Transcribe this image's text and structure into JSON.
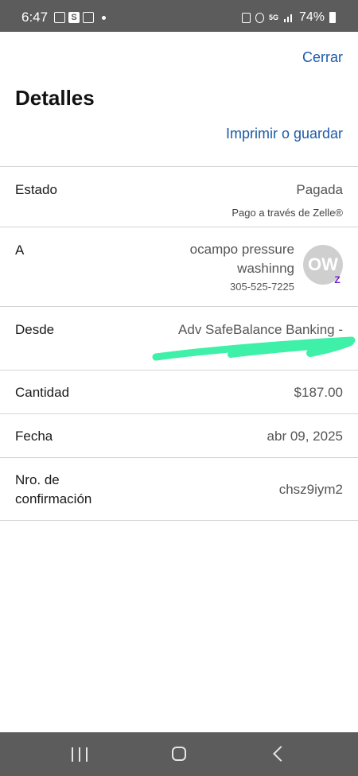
{
  "status_bar": {
    "time": "6:47",
    "battery": "74%",
    "network": "5G"
  },
  "header": {
    "close_label": "Cerrar",
    "title": "Detalles",
    "print_label": "Imprimir o guardar"
  },
  "details": {
    "estado": {
      "label": "Estado",
      "value": "Pagada",
      "sub": "Pago a través de Zelle®"
    },
    "recipient": {
      "label": "A",
      "name": "ocampo pressure washinng",
      "phone": "305-525-7225",
      "initials": "OW",
      "badge": "Z"
    },
    "desde": {
      "label": "Desde",
      "value": "Adv SafeBalance Banking -"
    },
    "cantidad": {
      "label": "Cantidad",
      "value": "$187.00"
    },
    "fecha": {
      "label": "Fecha",
      "value": "abr 09, 2025"
    },
    "confirmacion": {
      "label": "Nro. de confirmación",
      "value": "chsz9iym2"
    }
  },
  "colors": {
    "link": "#1d5aa8",
    "redaction": "#3ef0a8",
    "zelle": "#6d1ed4",
    "system_bar": "#5c5c5c"
  }
}
